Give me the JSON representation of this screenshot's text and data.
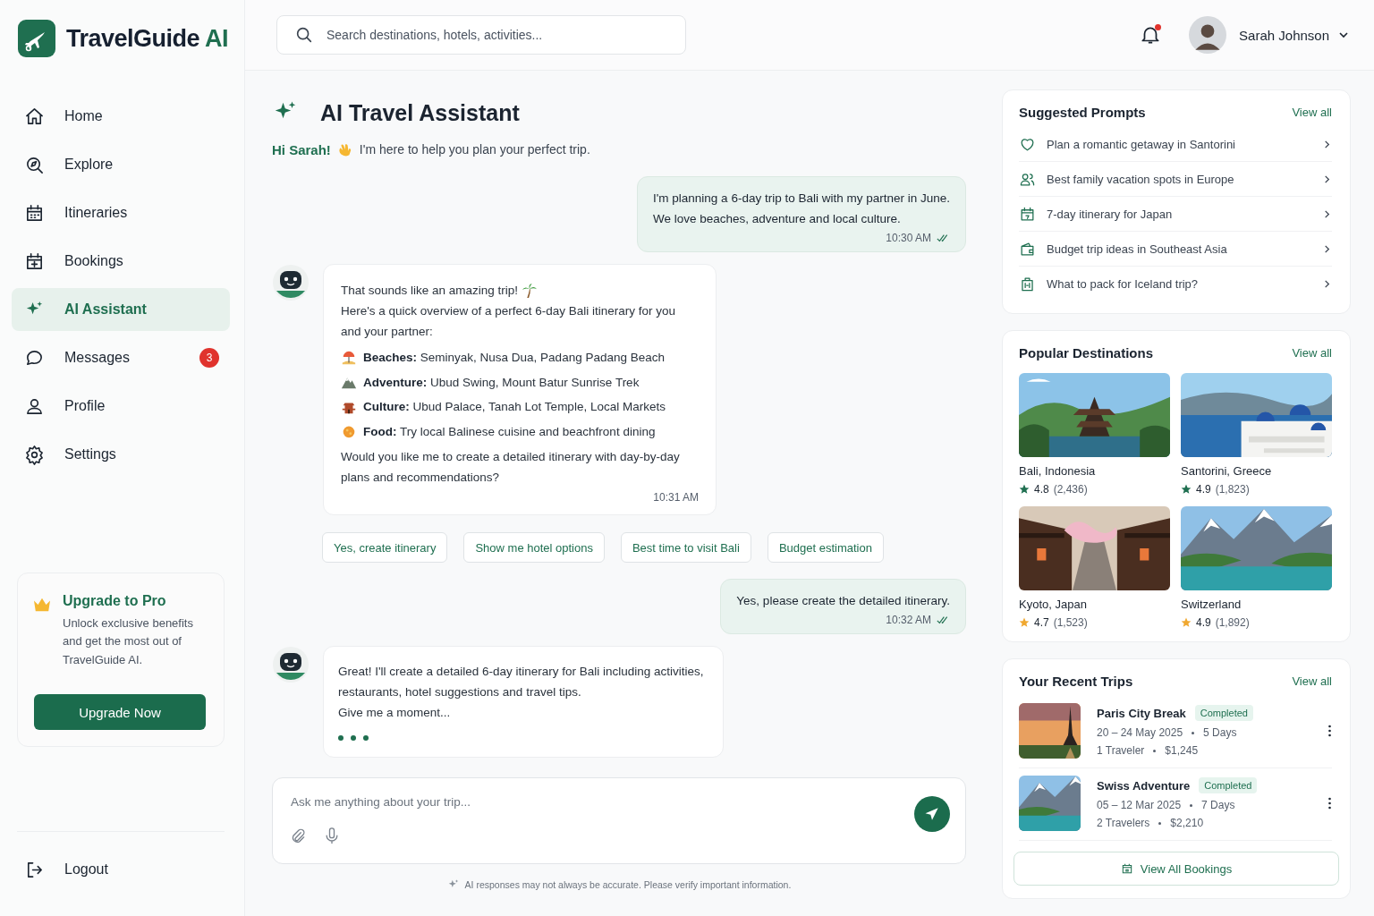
{
  "app": {
    "name": "TravelGuide",
    "name_accent": "AI"
  },
  "nav": [
    {
      "label": "Home",
      "selected": false
    },
    {
      "label": "Explore",
      "selected": false
    },
    {
      "label": "Itineraries",
      "selected": false
    },
    {
      "label": "Bookings",
      "selected": false
    },
    {
      "label": "AI Assistant",
      "selected": true
    },
    {
      "label": "Messages",
      "selected": false,
      "badge": "3"
    },
    {
      "label": "Profile",
      "selected": false
    },
    {
      "label": "Settings",
      "selected": false
    }
  ],
  "upgrade": {
    "title": "Upgrade to Pro",
    "text": "Unlock exclusive benefits and get the most out of TravelGuide AI.",
    "button": "Upgrade Now"
  },
  "logout": "Logout",
  "search": {
    "placeholder": "Search destinations, hotels, activities..."
  },
  "notifications": {
    "unread": true
  },
  "user": {
    "name": "Sarah Johnson"
  },
  "assistant": {
    "title": "AI Travel Assistant",
    "greeting_name": "Hi Sarah!",
    "greeting_text": "I'm here to help you plan your perfect trip."
  },
  "messages": [
    {
      "kind": "user",
      "lines": [
        "I'm planning a 6-day trip to Bali with my partner in June.",
        "We love beaches, adventure and local culture."
      ],
      "time": "10:30 AM",
      "read": true
    },
    {
      "kind": "bot",
      "intro": [
        "That sounds like an amazing trip!",
        "Here's a quick overview of a perfect 6-day Bali itinerary for you and your partner:"
      ],
      "items": [
        "**Beaches:** Seminyak, Nusa Dua, Padang Padang Beach",
        "**Adventure:** Ubud Swing, Mount Batur Sunrise Trek",
        "**Culture:** Ubud Palace, Tanah Lot Temple, Local Markets",
        "**Food:** Try local Balinese cuisine and beachfront dining"
      ],
      "outro": "Would you like me to create a detailed itinerary with day-by-day plans and recommendations?",
      "time": "10:31 AM"
    },
    {
      "kind": "quick_replies",
      "options": [
        "Yes, create itinerary",
        "Show me hotel options",
        "Best time to visit Bali",
        "Budget estimation"
      ]
    },
    {
      "kind": "user",
      "lines": [
        "Yes, please create the detailed itinerary."
      ],
      "time": "10:32 AM",
      "read": true
    },
    {
      "kind": "bot",
      "intro": [
        "Great! I'll create a detailed 6-day itinerary for Bali including activities, restaurants, hotel suggestions and travel tips.",
        "Give me a moment..."
      ],
      "typing": true
    }
  ],
  "composer": {
    "placeholder": "Ask me anything about your trip..."
  },
  "disclaimer": "AI responses may not always be accurate. Please verify important information.",
  "suggested_prompts": {
    "title": "Suggested Prompts",
    "link": "View all",
    "items": [
      "Plan a romantic getaway in Santorini",
      "Best family vacation spots in Europe",
      "7-day itinerary for Japan",
      "Budget trip ideas in Southeast Asia",
      "What to pack for Iceland trip?"
    ]
  },
  "popular_destinations": {
    "title": "Popular Destinations",
    "link": "View all",
    "items": [
      {
        "name": "Bali, Indonesia",
        "rating": "4.8",
        "reviews": "(2,436)",
        "color": "#1f6f50"
      },
      {
        "name": "Santorini, Greece",
        "rating": "4.9",
        "reviews": "(1,823)",
        "color": "#1f6f50"
      },
      {
        "name": "Kyoto, Japan",
        "rating": "4.7",
        "reviews": "(1,523)",
        "color": "#f0a830"
      },
      {
        "name": "Switzerland",
        "rating": "4.9",
        "reviews": "(1,892)",
        "color": "#f0a830"
      }
    ]
  },
  "recent_trips": {
    "title": "Your Recent Trips",
    "link": "View all",
    "items": [
      {
        "name": "Paris City Break",
        "status": "Completed",
        "dates": "20 – 24 May 2025",
        "days": "5 Days",
        "travelers": "1 Traveler",
        "price": "$1,245"
      },
      {
        "name": "Swiss Adventure",
        "status": "Completed",
        "dates": "05 – 12 Mar 2025",
        "days": "7 Days",
        "travelers": "2 Travelers",
        "price": "$2,210"
      }
    ],
    "button": "View All Bookings"
  }
}
